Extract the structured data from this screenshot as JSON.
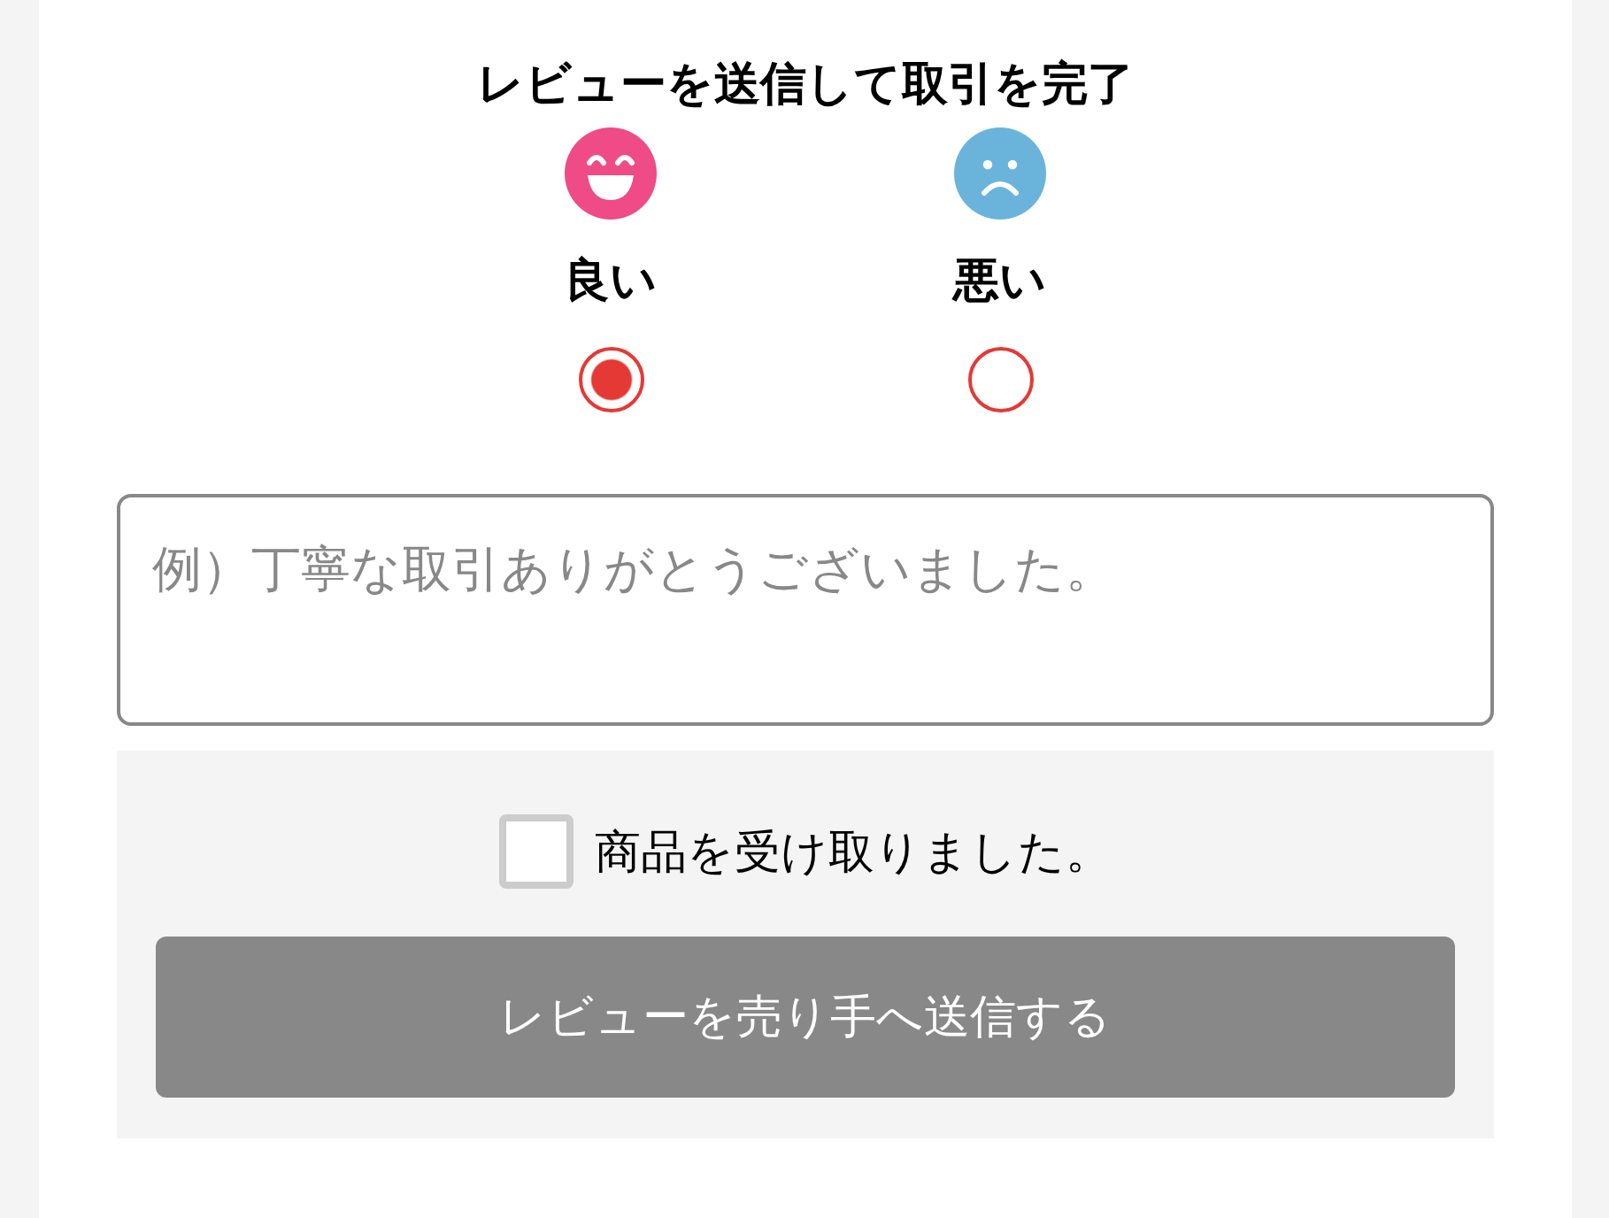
{
  "title": "レビューを送信して取引を完了",
  "options": [
    {
      "label": "良い",
      "kind": "good",
      "selected": true
    },
    {
      "label": "悪い",
      "kind": "bad",
      "selected": false
    }
  ],
  "comment": {
    "placeholder": "例）丁寧な取引ありがとうございました。"
  },
  "received": {
    "label": "商品を受け取りました。",
    "checked": false
  },
  "submit": {
    "label": "レビューを売り手へ送信する",
    "disabled": true
  }
}
